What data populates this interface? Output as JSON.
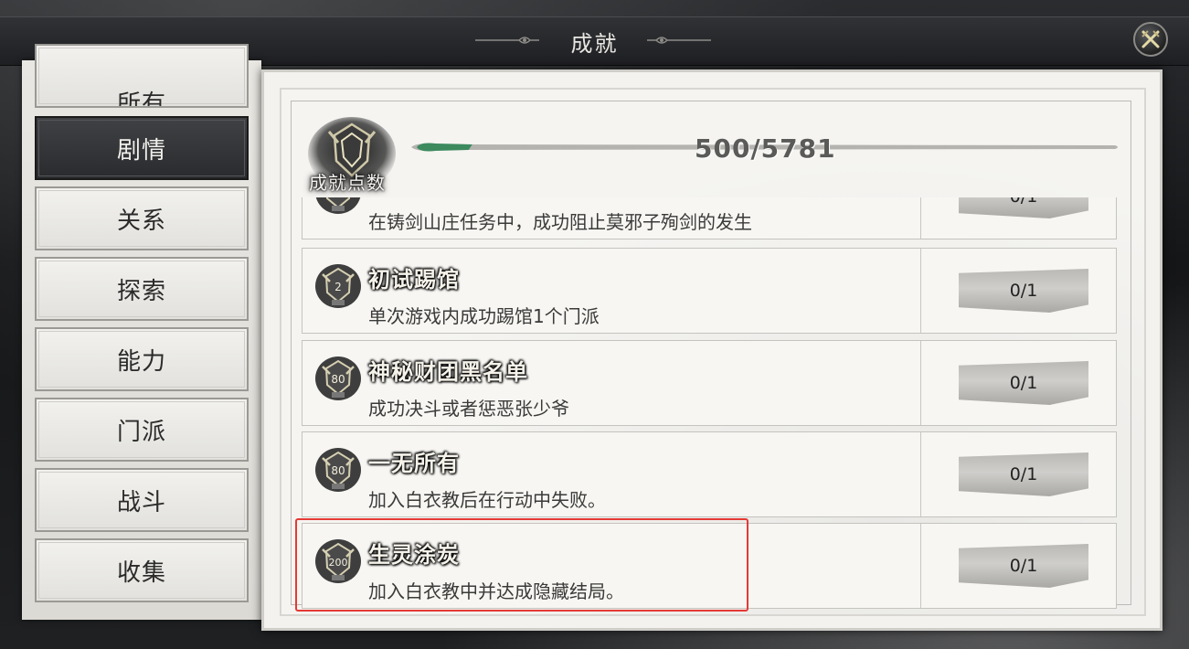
{
  "window": {
    "title": "成就"
  },
  "sidebar": {
    "items": [
      {
        "label": "所有"
      },
      {
        "label": "剧情"
      },
      {
        "label": "关系"
      },
      {
        "label": "探索"
      },
      {
        "label": "能力"
      },
      {
        "label": "门派"
      },
      {
        "label": "战斗"
      },
      {
        "label": "收集"
      }
    ],
    "active": "剧情"
  },
  "header": {
    "points_label": "成就点数",
    "progress_text": "500/5781",
    "progress_fraction": 0.086,
    "progress_color": "#3c8a5e"
  },
  "achievements": [
    {
      "badge": "",
      "title": "",
      "description": "在铸剑山庄任务中，成功阻止莫邪子殉剑的发生",
      "progress": "0/1"
    },
    {
      "badge": "2",
      "title": "初试踢馆",
      "description": "单次游戏内成功踢馆1个门派",
      "progress": "0/1"
    },
    {
      "badge": "80",
      "title": "神秘财团黑名单",
      "description": "成功决斗或者惩恶张少爷",
      "progress": "0/1"
    },
    {
      "badge": "80",
      "title": "一无所有",
      "description": "加入白衣教后在行动中失败。",
      "progress": "0/1"
    },
    {
      "badge": "200",
      "title": "生灵涂炭",
      "description": "加入白衣教中并达成隐藏结局。",
      "progress": "0/1"
    }
  ],
  "highlight_color": "#e53935"
}
